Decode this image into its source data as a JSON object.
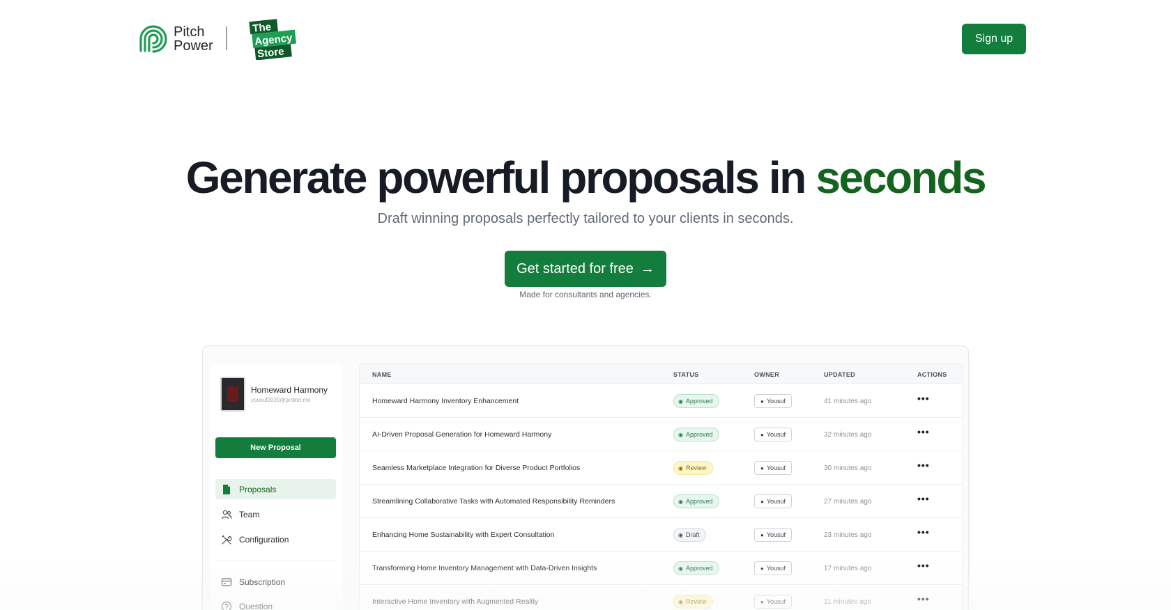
{
  "header": {
    "brand_line1": "Pitch",
    "brand_line2": "Power",
    "partner_logo_text": [
      "The",
      "Agency",
      "Store"
    ],
    "signup_label": "Sign up"
  },
  "hero": {
    "title_main": "Generate powerful proposals in",
    "title_accent": "seconds",
    "subtitle": "Draft winning proposals perfectly tailored to your clients in seconds.",
    "cta_label": "Get started for free",
    "cta_note": "Made for consultants and agencies."
  },
  "colors": {
    "brand_green": "#137d3d",
    "accent_text_green": "#14641f"
  },
  "app": {
    "profile": {
      "name": "Homeward Harmony",
      "email": "yousuf2020@proton.me"
    },
    "new_proposal_label": "New Proposal",
    "nav": [
      {
        "label": "Proposals",
        "icon": "document-icon",
        "active": true
      },
      {
        "label": "Team",
        "icon": "users-icon",
        "active": false
      },
      {
        "label": "Configuration",
        "icon": "tools-icon",
        "active": false
      },
      {
        "label": "Subscription",
        "icon": "credit-card-icon",
        "active": false
      },
      {
        "label": "Question",
        "icon": "help-circle-icon",
        "active": false
      }
    ],
    "table": {
      "headers": [
        "NAME",
        "STATUS",
        "OWNER",
        "UPDATED",
        "ACTIONS"
      ],
      "rows": [
        {
          "name": "Homeward Harmony Inventory Enhancement",
          "status": "Approved",
          "owner": "Yousuf",
          "updated": "41 minutes ago"
        },
        {
          "name": "AI-Driven Proposal Generation for Homeward Harmony",
          "status": "Approved",
          "owner": "Yousuf",
          "updated": "32 minutes ago"
        },
        {
          "name": "Seamless Marketplace Integration for Diverse Product Portfolios",
          "status": "Review",
          "owner": "Yousuf",
          "updated": "30 minutes ago"
        },
        {
          "name": "Streamlining Collaborative Tasks with Automated Responsibility Reminders",
          "status": "Approved",
          "owner": "Yousuf",
          "updated": "27 minutes ago"
        },
        {
          "name": "Enhancing Home Sustainability with Expert Consultation",
          "status": "Draft",
          "owner": "Yousuf",
          "updated": "23 minutes ago"
        },
        {
          "name": "Transforming Home Inventory Management with Data-Driven Insights",
          "status": "Approved",
          "owner": "Yousuf",
          "updated": "17 minutes ago"
        },
        {
          "name": "Interactive Home Inventory with Augmented Reality",
          "status": "Review",
          "owner": "Yousuf",
          "updated": "11 minutes ago"
        }
      ]
    }
  }
}
